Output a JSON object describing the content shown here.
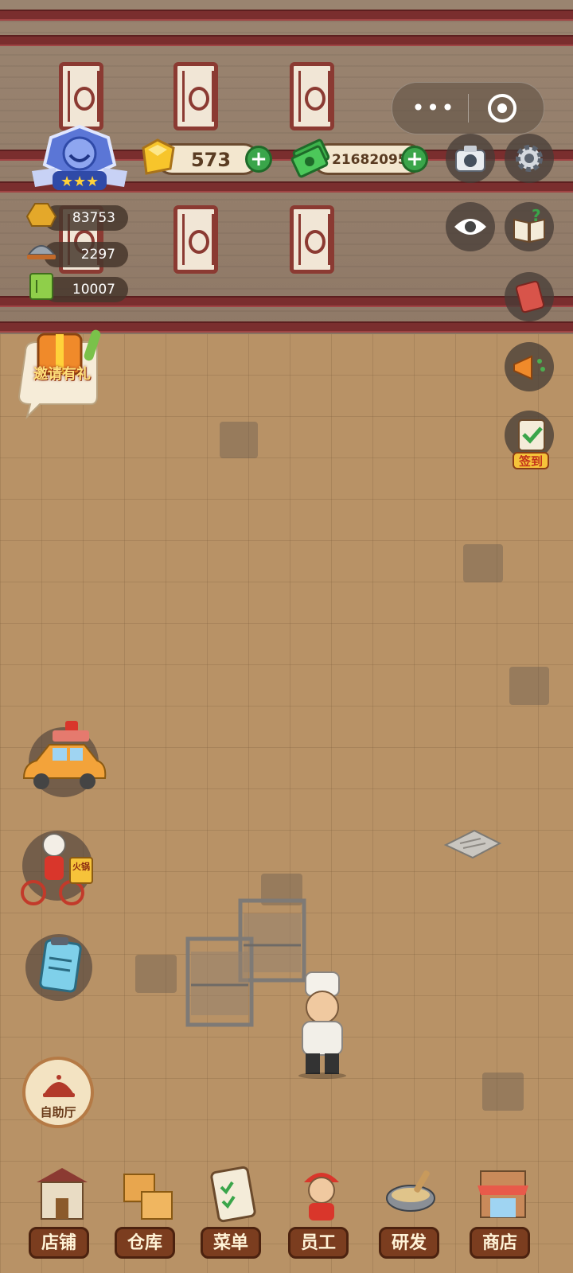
{
  "currency": {
    "gems": "573",
    "cash": "21682095"
  },
  "stats": [
    {
      "icon": "gold-ingot-icon",
      "value": "83753"
    },
    {
      "icon": "dish-icon",
      "value": "2297"
    },
    {
      "icon": "recipe-book-icon",
      "value": "10007"
    }
  ],
  "side_labels": {
    "invite": "邀请有礼",
    "checkin": "签到",
    "rider_sign": "火锅"
  },
  "buffet_label": "自助厅",
  "nav": [
    {
      "label": "店铺",
      "icon": "shop-building-icon"
    },
    {
      "label": "仓库",
      "icon": "warehouse-boxes-icon"
    },
    {
      "label": "菜单",
      "icon": "menu-clipboard-icon"
    },
    {
      "label": "员工",
      "icon": "staff-icon"
    },
    {
      "label": "研发",
      "icon": "research-wok-icon"
    },
    {
      "label": "商店",
      "icon": "store-icon"
    }
  ],
  "colors": {
    "plus_green": "#3aa54a",
    "beam_red": "#7a2e2e",
    "nav_brown": "#7b3d1f"
  }
}
